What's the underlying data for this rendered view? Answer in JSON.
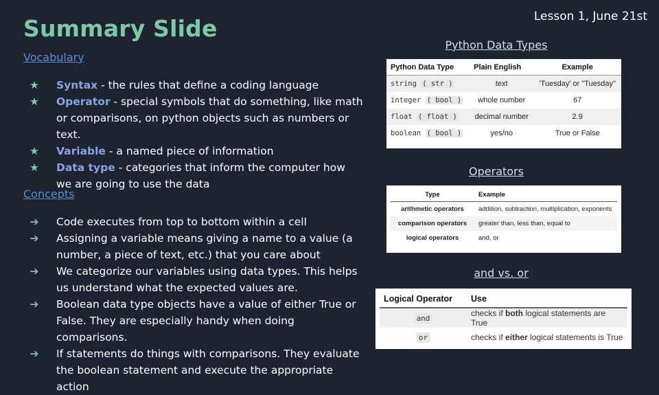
{
  "slide": {
    "title": "Summary Slide",
    "lesson": "Lesson 1, June 21st"
  },
  "vocabulary": {
    "heading": "Vocabulary",
    "bullet_glyph": "★",
    "items": [
      {
        "term": "Syntax",
        "definition": " - the rules that define a coding language"
      },
      {
        "term": "Operator",
        "definition": " - special symbols that do something, like math or comparisons, on python objects such as numbers or text."
      },
      {
        "term": "Variable",
        "definition": " - a named piece of information"
      },
      {
        "term": "Data type",
        "definition": " - categories that inform the computer how we are going to use the data"
      }
    ]
  },
  "concepts": {
    "heading": "Concepts",
    "bullet_glyph": "➔",
    "items": [
      "Code executes from top to bottom within a cell",
      "Assigning a variable means giving a name to a value (a number, a piece of text, etc.) that you care about",
      "We categorize our variables using data types. This helps us understand what the expected values are.",
      "Boolean data type objects have a value of either True or False. They are especially handy when doing comparisons.",
      "If statements do things with comparisons.  They evaluate the boolean statement and execute the appropriate action"
    ]
  },
  "data_types": {
    "title": "Python Data Types",
    "headers": [
      "Python Data Type",
      "Plain English",
      "Example"
    ],
    "rows": [
      {
        "type": "string",
        "alias": "str",
        "english": "text",
        "example": "'Tuesday' or \"Tuesday\""
      },
      {
        "type": "integer",
        "alias": "bool",
        "english": "whole number",
        "example": "67"
      },
      {
        "type": "float",
        "alias": "float",
        "english": "decimal number",
        "example": "2.9"
      },
      {
        "type": "boolean",
        "alias": "bool",
        "english": "yes/no",
        "example": "True or False"
      }
    ]
  },
  "operators": {
    "title": "Operators",
    "headers": [
      "Type",
      "Example"
    ],
    "rows": [
      {
        "type": "arithmetic operators",
        "example": "addition, subtraction, multiplication, exponents"
      },
      {
        "type": "comparison operators",
        "example": "greater than, less than, equal to"
      },
      {
        "type": "logical operators",
        "example": "and, or"
      }
    ]
  },
  "and_or": {
    "title": "and vs. or",
    "headers": [
      "Logical Operator",
      "Use"
    ],
    "rows": [
      {
        "op": "and",
        "pre": "checks if ",
        "key": "both",
        "post": " logical statements are True"
      },
      {
        "op": "or",
        "pre": "checks if ",
        "key": "either",
        "post": " logical statements is True"
      }
    ]
  }
}
